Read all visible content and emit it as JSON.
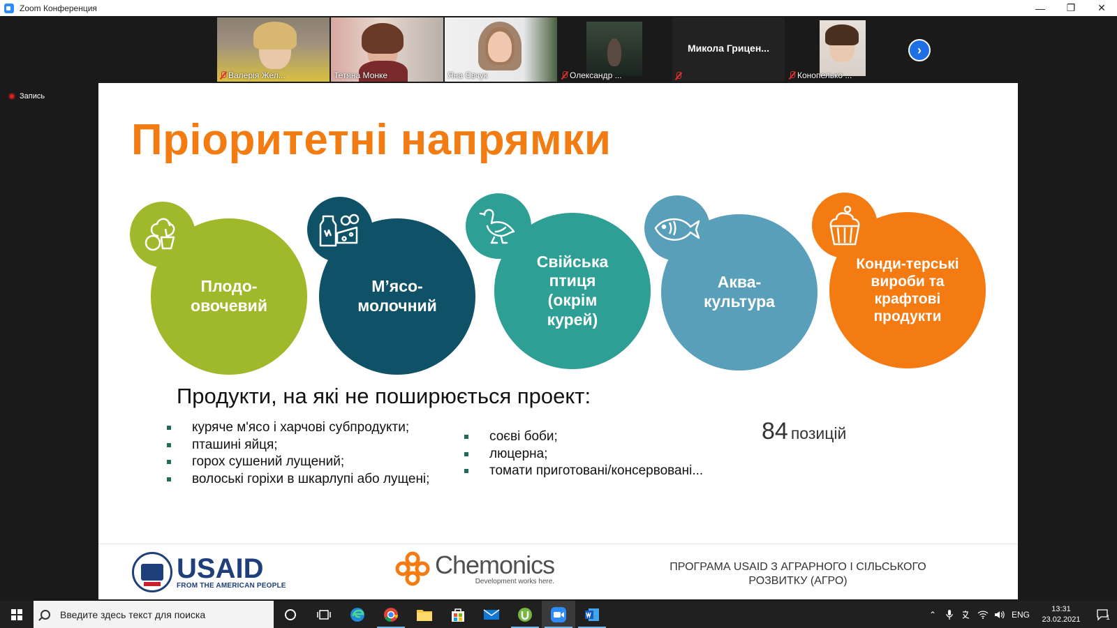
{
  "window": {
    "title": "Zoom Конференция"
  },
  "participants": [
    {
      "name": "Валерія Жел...",
      "muted": true
    },
    {
      "name": "Тетяна Монке",
      "muted": false,
      "active": true
    },
    {
      "name": "Яна Євчук",
      "muted": false
    },
    {
      "name": "Олександр ...",
      "muted": true
    },
    {
      "name": "Микола  Грицен...",
      "muted": true,
      "video": false
    },
    {
      "name": "Конопелько ...",
      "muted": true
    }
  ],
  "recording": {
    "label": "Запись"
  },
  "slide": {
    "title": "Пріоритетні напрямки",
    "directions": [
      {
        "label": "Плодо-овочевий",
        "color": "#9fb92a",
        "badge_color": "#9fb92a",
        "icon": "vegetables-icon"
      },
      {
        "label": "М’ясо-молочний",
        "color": "#0f5268",
        "badge_color": "#0f5268",
        "icon": "milk-cheese-icon"
      },
      {
        "label": "Свійська птиця (окрім курей)",
        "color": "#2e9f95",
        "badge_color": "#2e9f95",
        "icon": "goose-icon"
      },
      {
        "label": "Аква-культура",
        "color": "#5a9fb9",
        "badge_color": "#5a9fb9",
        "icon": "fish-icon"
      },
      {
        "label": "Конди-терські вироби та крафтові продукти",
        "color": "#f47b12",
        "badge_color": "#f47b12",
        "icon": "cupcake-icon"
      }
    ],
    "excluded_title": "Продукти, на які не поширюється проект:",
    "excluded_col1": [
      "куряче м'ясо і харчові субпродукти;",
      "пташині яйця;",
      "горох сушений лущений;",
      "волоські горіхи в шкарлупі або лущені;"
    ],
    "excluded_col2": [
      "соєві боби;",
      "люцерна;",
      "томати приготовані/консервовані..."
    ],
    "count_number": "84",
    "count_unit": "позицій",
    "footer": {
      "usaid": "USAID",
      "usaid_sub": "FROM THE AMERICAN PEOPLE",
      "chemonics": "Chemonics",
      "chemonics_tagline": "Development works here.",
      "program": "ПРОГРАМА USAID З АГРАРНОГО І СІЛЬСЬКОГО РОЗВИТКУ (АГРО)"
    }
  },
  "taskbar": {
    "search_placeholder": "Введите здесь текст для поиска",
    "language": "ENG",
    "time": "13:31",
    "date": "23.02.2021",
    "notification_count": "1"
  }
}
